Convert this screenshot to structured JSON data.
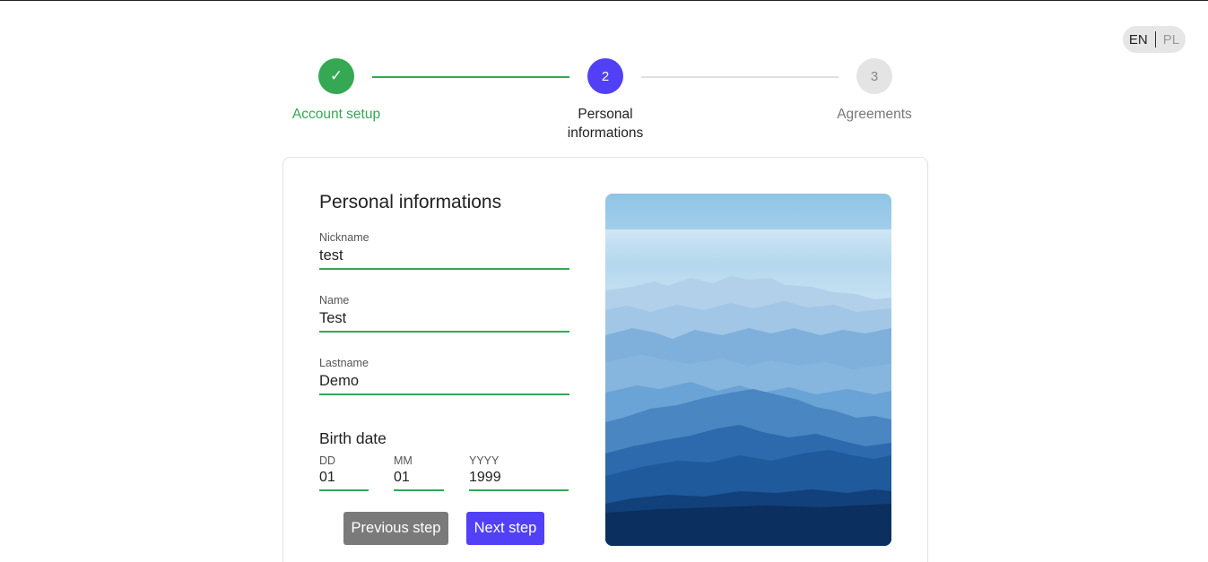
{
  "language": {
    "current": "EN",
    "other": "PL"
  },
  "stepper": {
    "steps": [
      {
        "number": "✓",
        "label": "Account setup",
        "state": "completed"
      },
      {
        "number": "2",
        "label": "Personal informations",
        "state": "active"
      },
      {
        "number": "3",
        "label": "Agreements",
        "state": "pending"
      }
    ]
  },
  "form": {
    "title": "Personal informations",
    "nickname": {
      "label": "Nickname",
      "value": "test"
    },
    "name": {
      "label": "Name",
      "value": "Test"
    },
    "lastname": {
      "label": "Lastname",
      "value": "Demo"
    },
    "birth_date": {
      "title": "Birth date",
      "day": {
        "label": "DD",
        "value": "01"
      },
      "month": {
        "label": "MM",
        "value": "01"
      },
      "year": {
        "label": "YYYY",
        "value": "1999"
      }
    }
  },
  "buttons": {
    "previous": "Previous step",
    "next": "Next step"
  },
  "colors": {
    "success": "#34a853",
    "primary": "#5140f5",
    "secondary": "#7a7a7a"
  },
  "image": {
    "subject": "misty blue mountain ranges"
  }
}
